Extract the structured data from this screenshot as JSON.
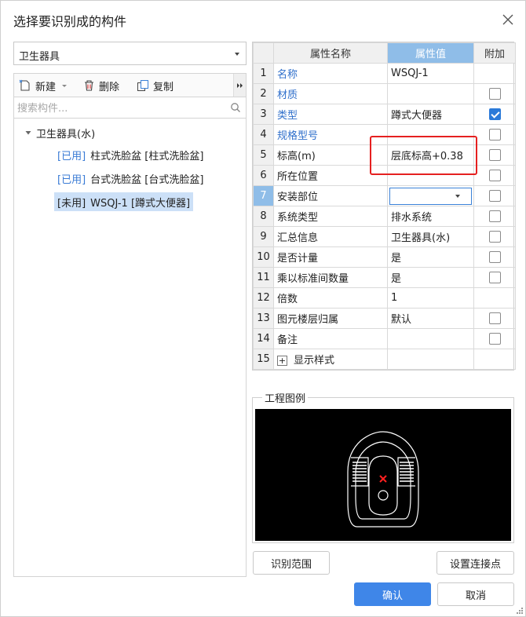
{
  "dialog": {
    "title": "选择要识别成的构件"
  },
  "left": {
    "category_select": "卫生器具",
    "toolbar": {
      "new_label": "新建",
      "delete_label": "删除",
      "copy_label": "复制"
    },
    "search_placeholder": "搜索构件...",
    "tree": {
      "root_label": "卫生器具(水)",
      "items": [
        {
          "tag": "[已用]",
          "name": "柱式洗脸盆 [柱式洗脸盆]",
          "selected": false
        },
        {
          "tag": "[已用]",
          "name": "台式洗脸盆 [台式洗脸盆]",
          "selected": false
        },
        {
          "tag": "[未用]",
          "name": "WSQJ-1 [蹲式大便器]",
          "selected": true
        }
      ]
    }
  },
  "props": {
    "headers": {
      "name": "属性名称",
      "value": "属性值",
      "extra": "附加"
    },
    "rows": [
      {
        "num": "1",
        "name": "名称",
        "value": "WSQJ-1",
        "checkbox": false,
        "checked": false,
        "link": true
      },
      {
        "num": "2",
        "name": "材质",
        "value": "",
        "checkbox": true,
        "checked": false,
        "link": true
      },
      {
        "num": "3",
        "name": "类型",
        "value": "蹲式大便器",
        "checkbox": true,
        "checked": true,
        "link": true
      },
      {
        "num": "4",
        "name": "规格型号",
        "value": "",
        "checkbox": true,
        "checked": false,
        "link": true
      },
      {
        "num": "5",
        "name": "标高(m)",
        "value": "层底标高+0.38",
        "checkbox": true,
        "checked": false,
        "link": false
      },
      {
        "num": "6",
        "name": "所在位置",
        "value": "",
        "checkbox": true,
        "checked": false,
        "link": false
      },
      {
        "num": "7",
        "name": "安装部位",
        "value": "",
        "checkbox": true,
        "checked": false,
        "link": false
      },
      {
        "num": "8",
        "name": "系统类型",
        "value": "排水系统",
        "checkbox": true,
        "checked": false,
        "link": false
      },
      {
        "num": "9",
        "name": "汇总信息",
        "value": "卫生器具(水)",
        "checkbox": true,
        "checked": false,
        "link": false
      },
      {
        "num": "10",
        "name": "是否计量",
        "value": "是",
        "checkbox": true,
        "checked": false,
        "link": false
      },
      {
        "num": "11",
        "name": "乘以标准间数量",
        "value": "是",
        "checkbox": true,
        "checked": false,
        "link": false
      },
      {
        "num": "12",
        "name": "倍数",
        "value": "1",
        "checkbox": false,
        "checked": false,
        "link": false
      },
      {
        "num": "13",
        "name": "图元楼层归属",
        "value": "默认",
        "checkbox": true,
        "checked": false,
        "link": false
      },
      {
        "num": "14",
        "name": "备注",
        "value": "",
        "checkbox": true,
        "checked": false,
        "link": false
      },
      {
        "num": "15",
        "name": "显示样式",
        "value": "",
        "checkbox": false,
        "checked": false,
        "link": false
      }
    ]
  },
  "legend": {
    "title": "工程图例"
  },
  "buttons": {
    "identify_range": "识别范围",
    "set_connection": "设置连接点",
    "ok": "确认",
    "cancel": "取消"
  },
  "colors": {
    "accent": "#3f86e8",
    "link": "#2f6fcb",
    "header_active": "#8fbde8",
    "highlight": "#e52020",
    "selection": "#cce0f7"
  }
}
